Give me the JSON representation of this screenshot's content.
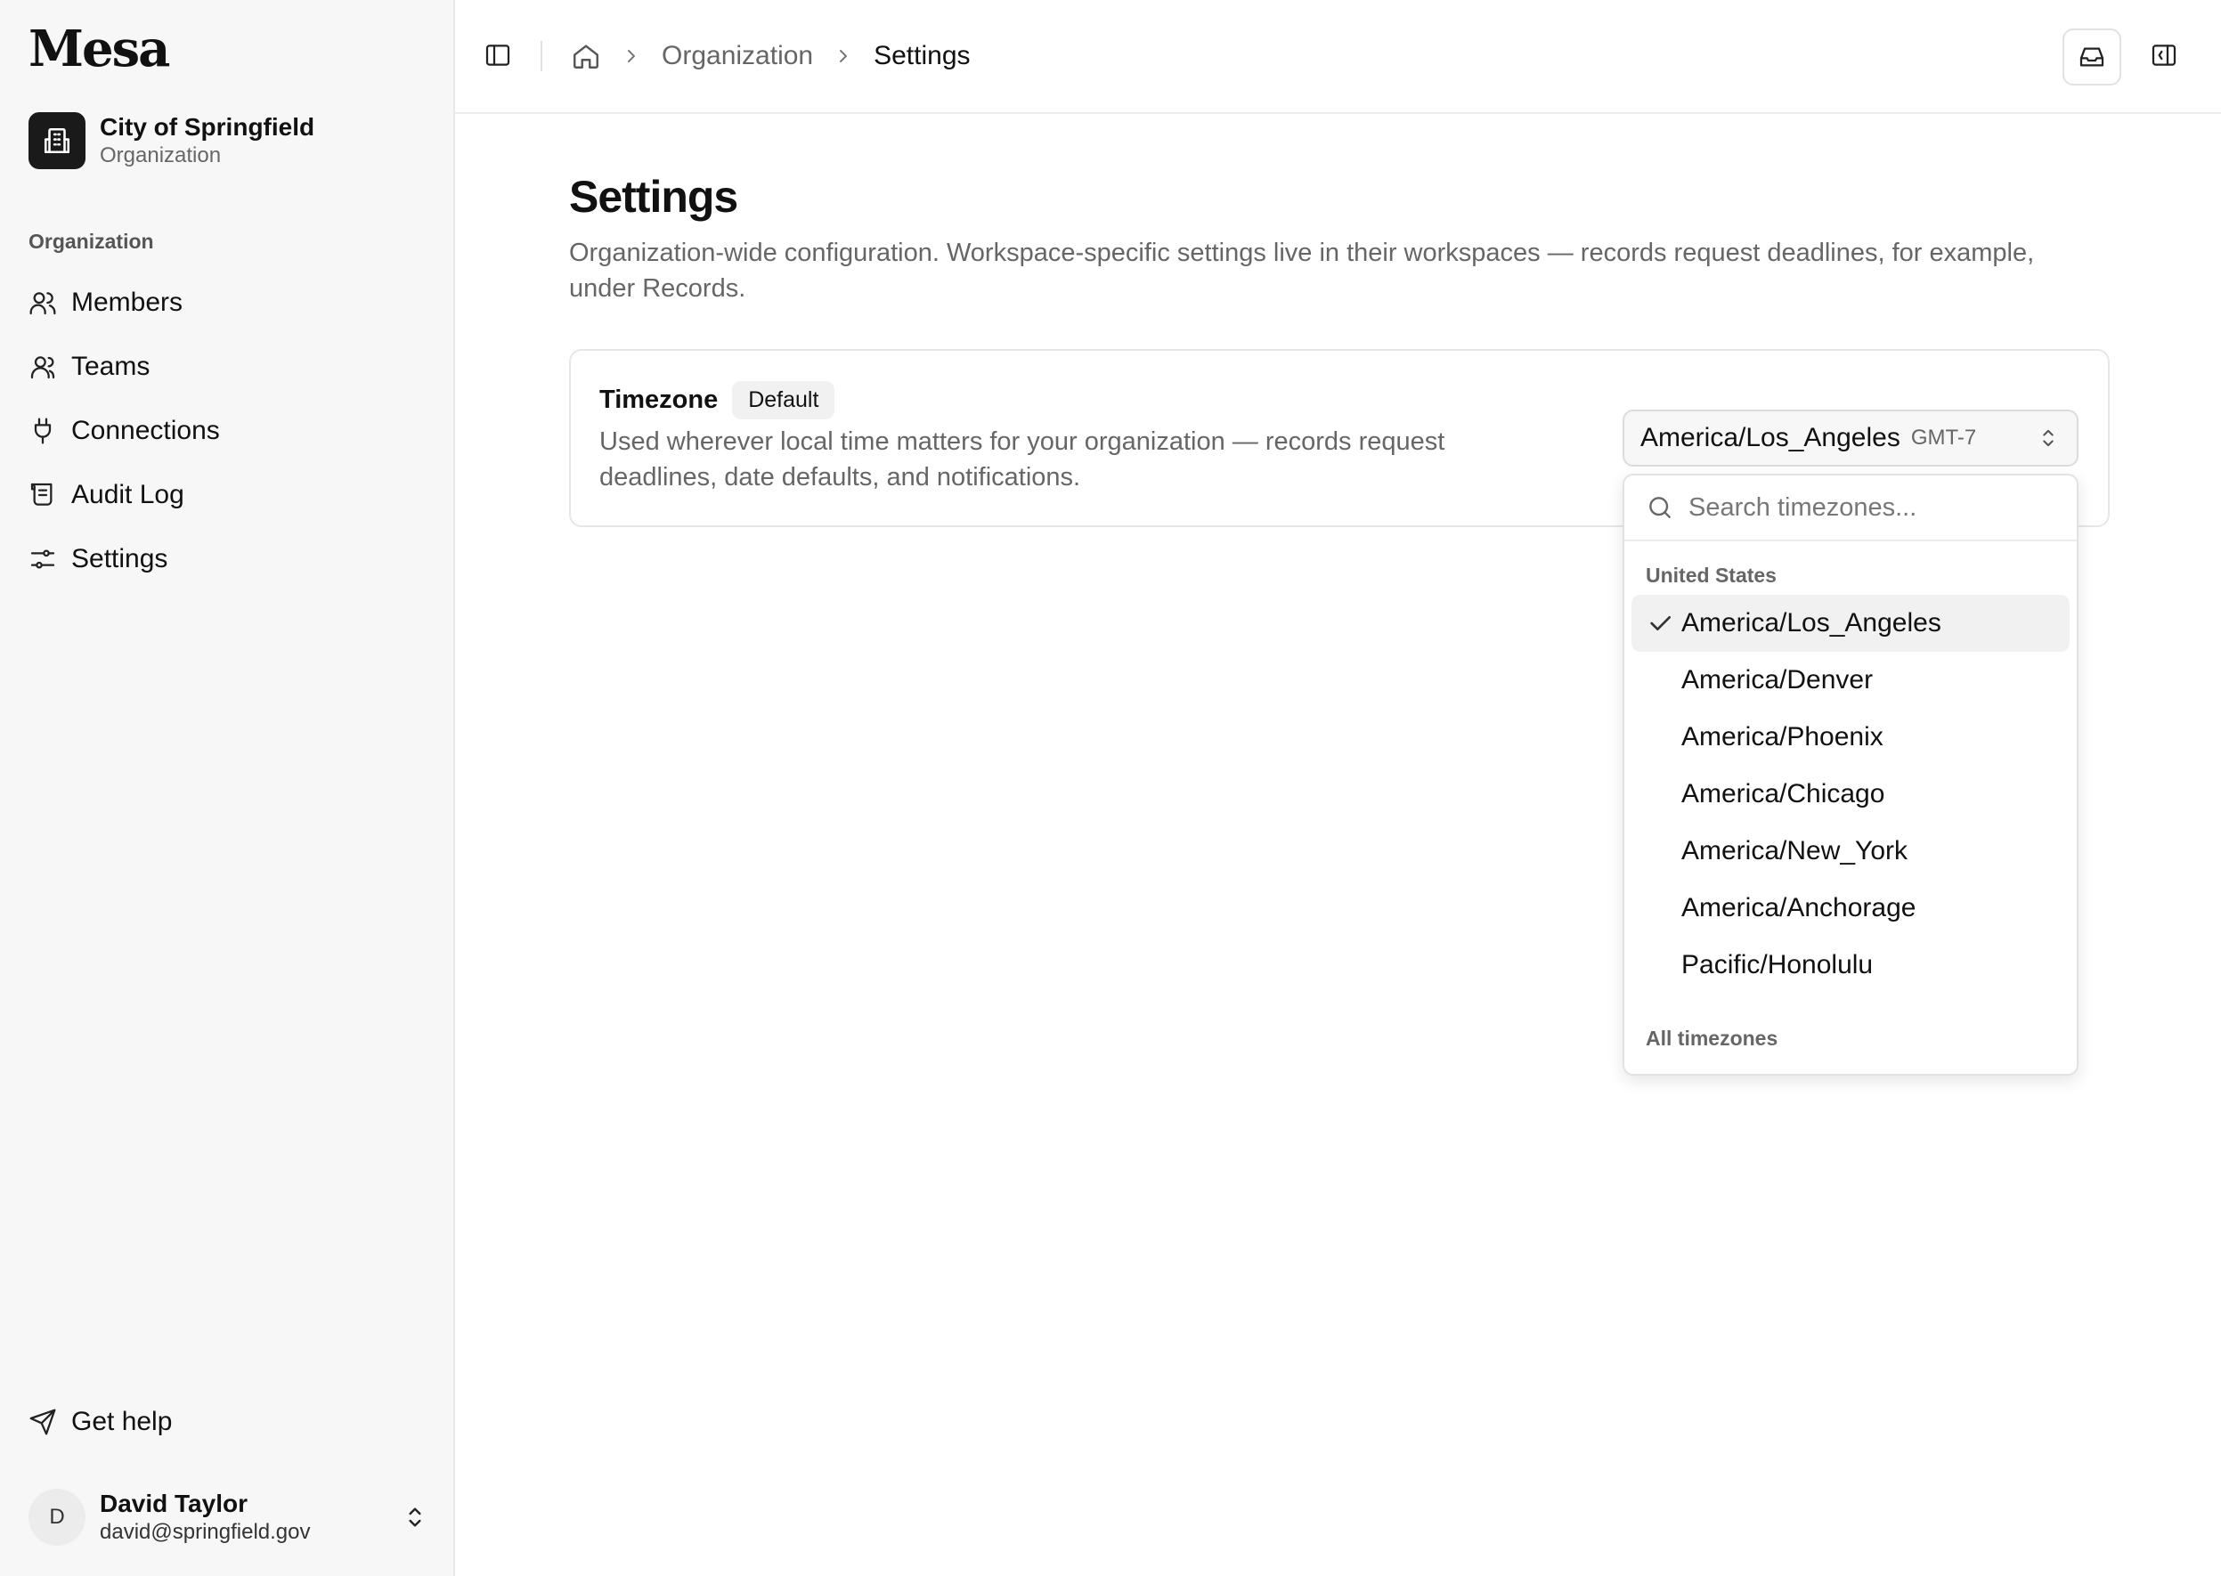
{
  "app": {
    "logo": "Mesa"
  },
  "org": {
    "name": "City of Springfield",
    "type": "Organization"
  },
  "sidebar": {
    "section_label": "Organization",
    "items": [
      {
        "label": "Members",
        "icon": "users-icon"
      },
      {
        "label": "Teams",
        "icon": "team-icon"
      },
      {
        "label": "Connections",
        "icon": "plug-icon"
      },
      {
        "label": "Audit Log",
        "icon": "scroll-icon"
      },
      {
        "label": "Settings",
        "icon": "sliders-icon"
      }
    ],
    "help_label": "Get help"
  },
  "user": {
    "initial": "D",
    "name": "David Taylor",
    "email": "david@springfield.gov"
  },
  "breadcrumb": {
    "org": "Organization",
    "current": "Settings"
  },
  "page": {
    "title": "Settings",
    "description": "Organization-wide configuration. Workspace-specific settings live in their workspaces — records request deadlines, for example, under Records."
  },
  "timezone": {
    "label": "Timezone",
    "badge": "Default",
    "description": "Used wherever local time matters for your organization — records request deadlines, date defaults, and notifications.",
    "selected": "America/Los_Angeles",
    "offset": "GMT-7"
  },
  "dropdown": {
    "search_placeholder": "Search timezones...",
    "group_us": "United States",
    "options": [
      "America/Los_Angeles",
      "America/Denver",
      "America/Phoenix",
      "America/Chicago",
      "America/New_York",
      "America/Anchorage",
      "Pacific/Honolulu"
    ],
    "group_all": "All timezones"
  }
}
